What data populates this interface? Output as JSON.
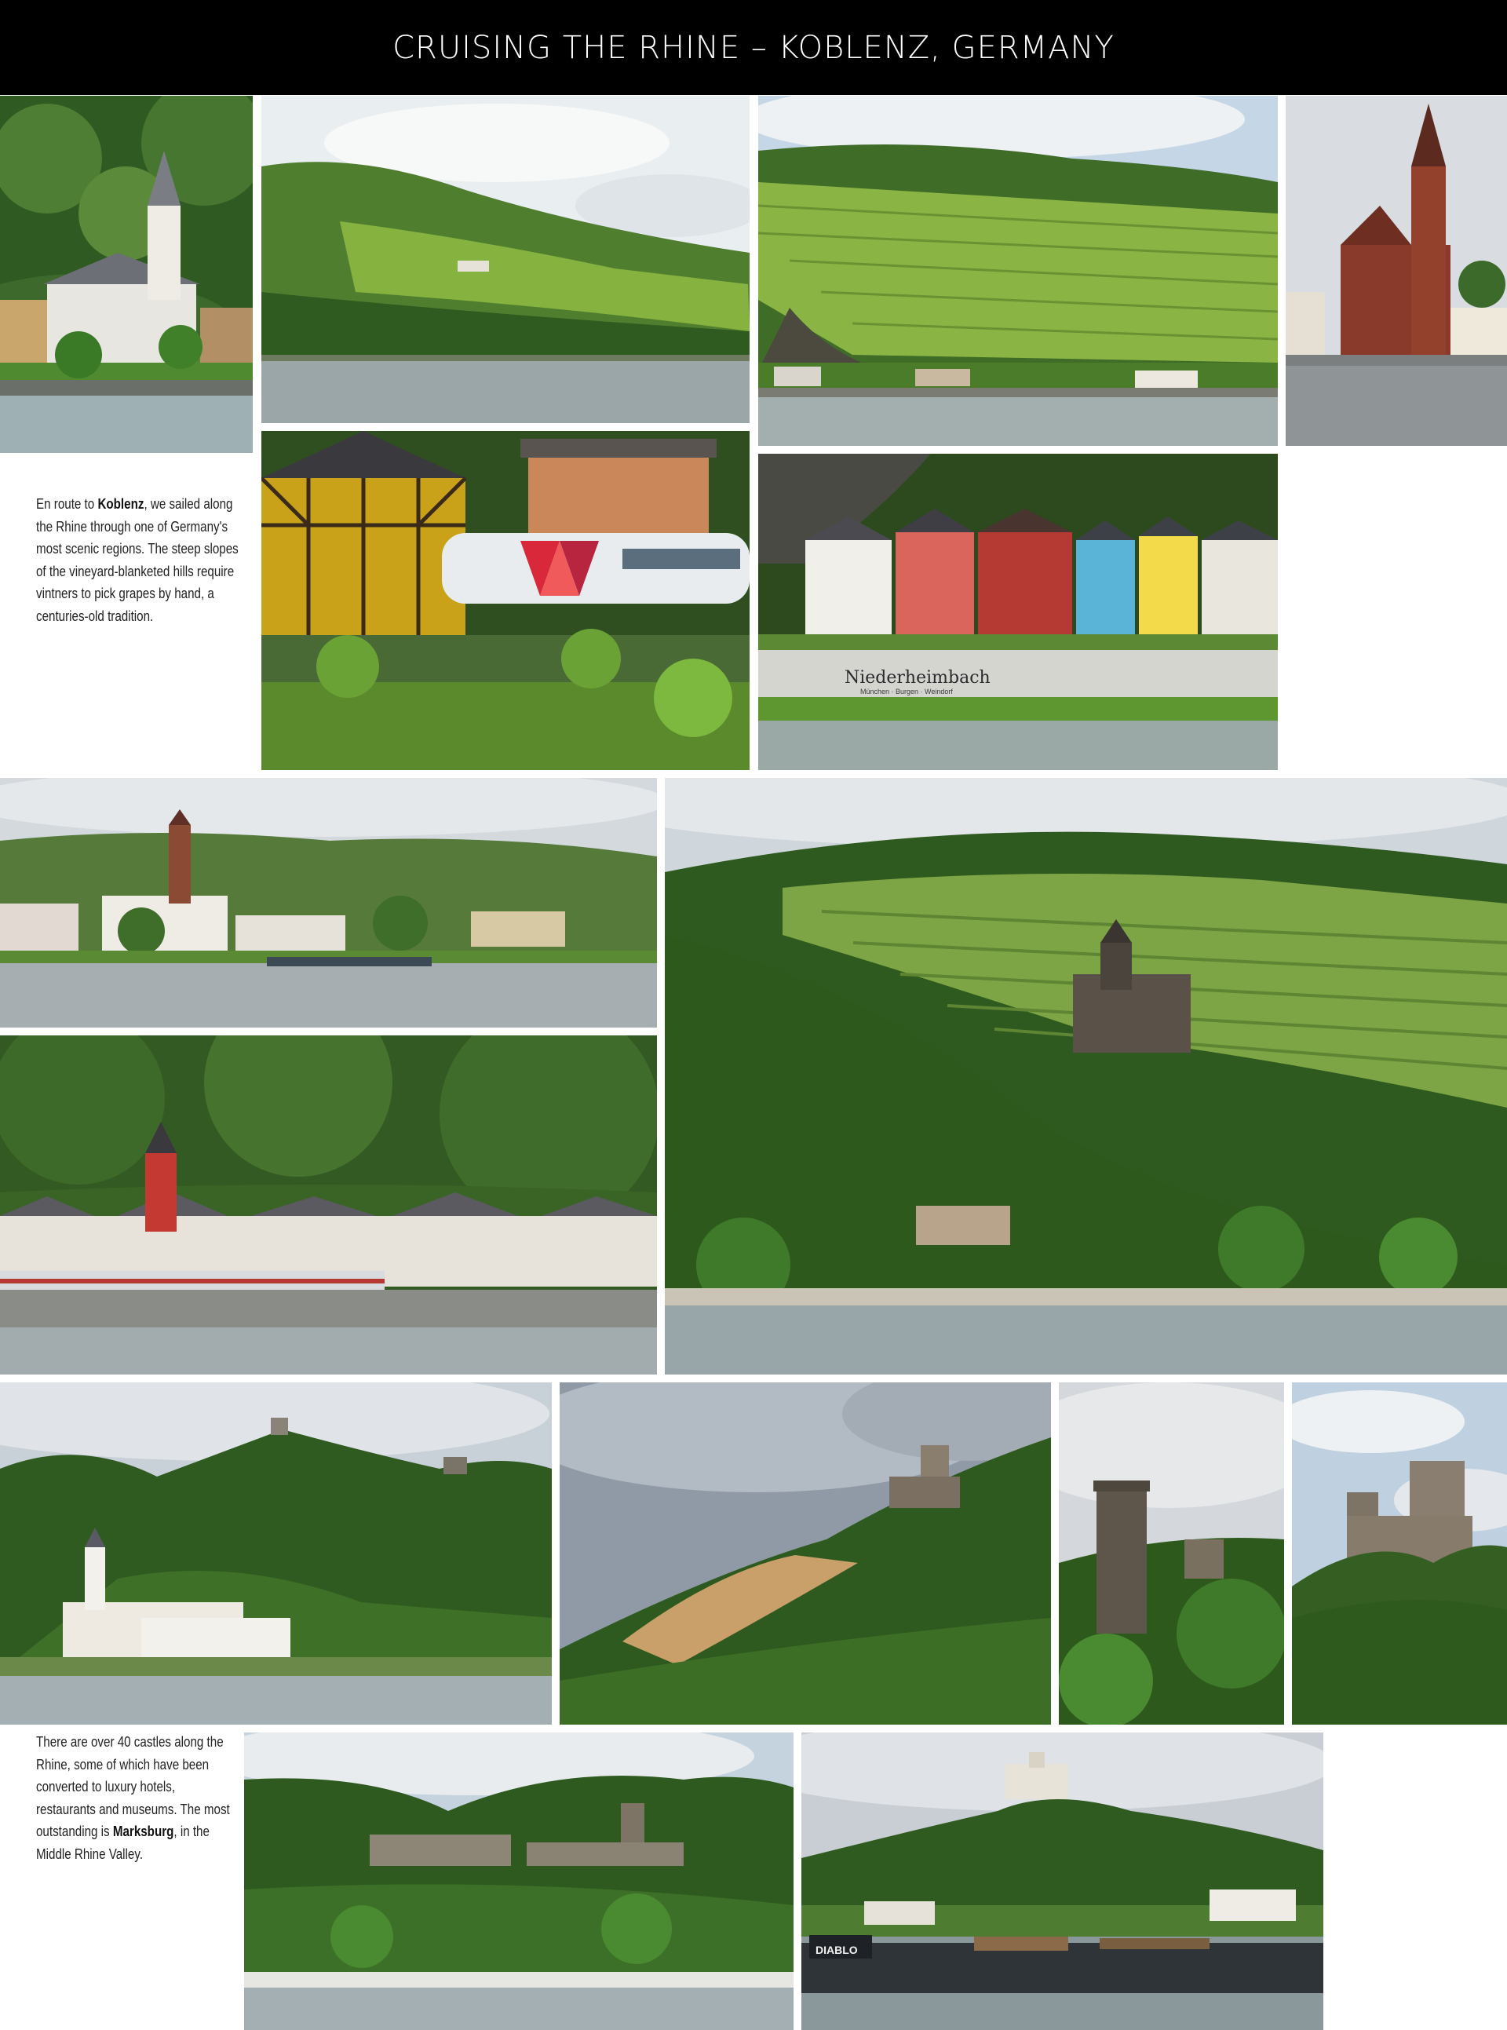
{
  "header": {
    "title": "CRUISING THE RHINE – KOBLENZ, GERMANY"
  },
  "captions": {
    "top": {
      "pre": "En route to ",
      "bold": "Koblenz",
      "post": ", we sailed along the Rhine through one of Germany's most scenic regions. The steep slopes of the vineyard-blanketed hills require vintners to pick grapes by hand, a centuries-old tradition."
    },
    "bottom": {
      "pre": "There are over 40 castles along the Rhine, some of which have been converted to luxury hotels, restaurants and museums. The most outstanding is ",
      "bold": "Marksburg",
      "post": ", in the Middle Rhine Valley."
    }
  },
  "signs": {
    "town_name": "Niederheimbach",
    "town_sub": "München · Burgen · Weindorf",
    "barge_name": "DIABLO"
  },
  "colors": {
    "header_bg": "#000000",
    "sky": "#cfd8e2",
    "forest": "#3f6a2a",
    "vineyard": "#7fa83c",
    "river": "#8f9ea3"
  }
}
